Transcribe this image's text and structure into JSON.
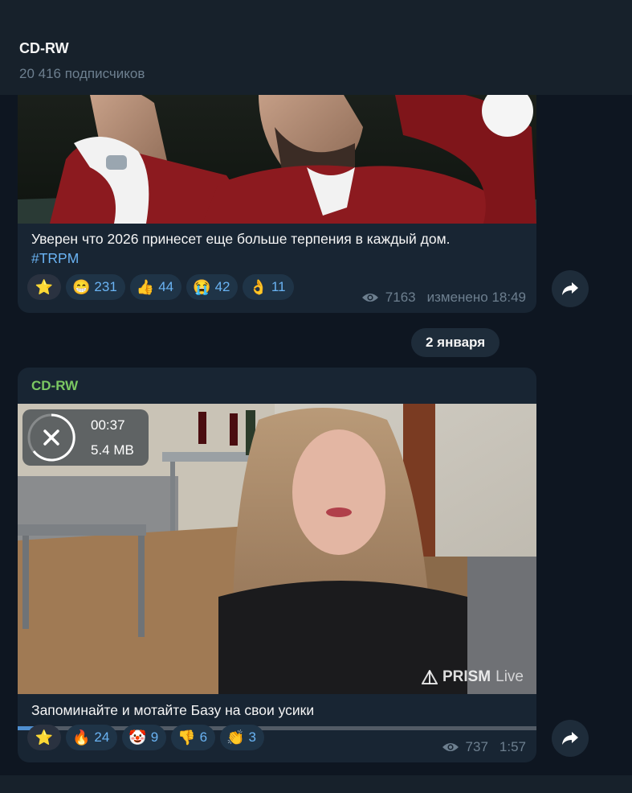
{
  "channel": {
    "title": "CD-RW",
    "subscribers": "20 416 подписчиков"
  },
  "post1": {
    "caption": "Уверен что 2026 принесет еще больше терпения в каждый дом.",
    "hashtag": "#TRPM",
    "reactions": [
      {
        "emoji": "⭐",
        "count": ""
      },
      {
        "emoji": "😁",
        "count": "231"
      },
      {
        "emoji": "👍",
        "count": "44"
      },
      {
        "emoji": "😭",
        "count": "42"
      },
      {
        "emoji": "👌",
        "count": "11"
      }
    ],
    "views": "7163",
    "edited": "изменено 18:49"
  },
  "date_separator": "2 января",
  "post2": {
    "sender": "CD-RW",
    "video_duration": "00:37",
    "video_size": "5.4 MB",
    "watermark_brand": "PRISM",
    "watermark_live": "Live",
    "playback_progress": 0.055,
    "caption": "Запоминайте и мотайте Базу на свои усики",
    "reactions": [
      {
        "emoji": "⭐",
        "count": ""
      },
      {
        "emoji": "🔥",
        "count": "24"
      },
      {
        "emoji": "🤡",
        "count": "9"
      },
      {
        "emoji": "👎",
        "count": "6"
      },
      {
        "emoji": "👏",
        "count": "3"
      }
    ],
    "views": "737",
    "time": "1:57"
  },
  "colors": {
    "link": "#6ab3f3",
    "sender": "#7bc862",
    "bubble": "#182533",
    "background": "#0e1621"
  },
  "icons": {
    "views": "eye-icon",
    "share": "share-arrow-icon",
    "download_cancel": "close-icon"
  }
}
